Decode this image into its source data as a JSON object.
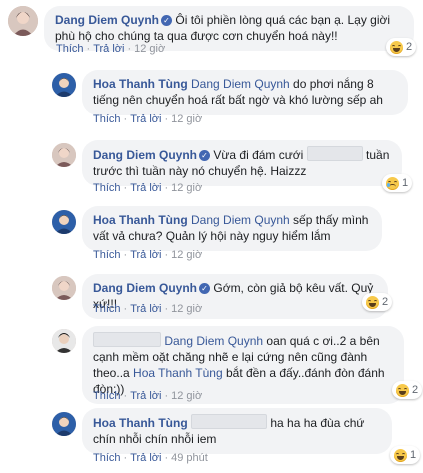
{
  "labels": {
    "like": "Thích",
    "reply": "Trả lời",
    "sep": "·"
  },
  "comments": [
    {
      "author": "Dang Diem Quynh",
      "text": "Ôi tôi phiền lòng quá các bạn ạ. Lạy giời phù hộ cho chúng ta qua được cơn chuyển hoá này!!",
      "time": "12 giờ",
      "reaction": "laugh",
      "reaction_count": "2"
    },
    {
      "author": "Hoa Thanh Tùng",
      "mention": "Dang Diem Quynh",
      "text": " do phơi nắng 8 tiếng nên chuyển hoá rất bất ngờ và khó lường sếp ah",
      "time": "12 giờ"
    },
    {
      "author": "Dang Diem Quynh",
      "text_before": "Vừa đi đám cưới",
      "text_after": " tuần trước thì tuần này nó chuyển hệ. Haizzz",
      "time": "12 giờ",
      "reaction": "sad",
      "reaction_count": "1"
    },
    {
      "author": "Hoa Thanh Tùng",
      "mention": "Dang Diem Quynh",
      "text": " sếp thấy mình vất vả chưa? Quản lý hội này nguy hiểm lắm",
      "time": "12 giờ"
    },
    {
      "author": "Dang Diem Quynh",
      "text": "Gớm, còn giả bộ kêu vất. Quỷ xứ!!!",
      "time": "12 giờ",
      "reaction": "laugh",
      "reaction_count": "2"
    },
    {
      "mention": "Dang Diem Quynh",
      "text": " oan quá c ơi..2 a bên cạnh mềm oặt chăng nhẽ e lại cứng nên cũng đành theo..a ",
      "mention2": "Hoa Thanh Tùng",
      "text2": " bắt đền a đấy..đánh đòn đánh đòn:))",
      "time": "12 giờ",
      "reaction": "laugh",
      "reaction_count": "2"
    },
    {
      "author": "Hoa Thanh Tùng",
      "text": " ha ha ha đùa chứ chín nhỗi chín nhỗi iem",
      "time": "49 phút",
      "reaction": "laugh",
      "reaction_count": "1"
    }
  ]
}
